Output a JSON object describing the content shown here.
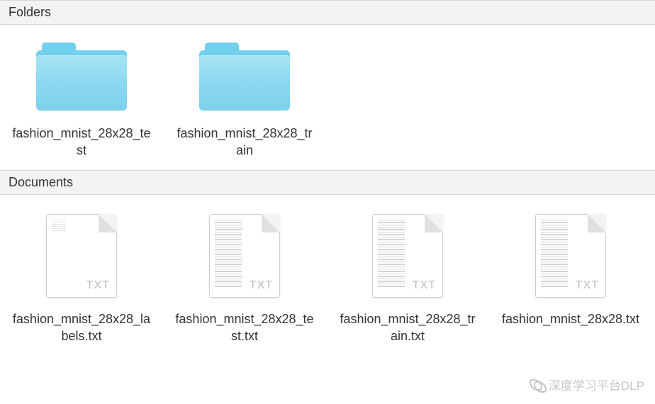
{
  "sections": {
    "folders": {
      "header": "Folders",
      "items": [
        {
          "name": "fashion_mnist_28x28_test"
        },
        {
          "name": "fashion_mnist_28x28_train"
        }
      ]
    },
    "documents": {
      "header": "Documents",
      "items": [
        {
          "name": "fashion_mnist_28x28_labels.txt",
          "ext": "TXT",
          "dense": false
        },
        {
          "name": "fashion_mnist_28x28_test.txt",
          "ext": "TXT",
          "dense": true
        },
        {
          "name": "fashion_mnist_28x28_train.txt",
          "ext": "TXT",
          "dense": true
        },
        {
          "name": "fashion_mnist_28x28.txt",
          "ext": "TXT",
          "dense": true
        }
      ]
    }
  },
  "watermark": "深度学习平台DLP"
}
